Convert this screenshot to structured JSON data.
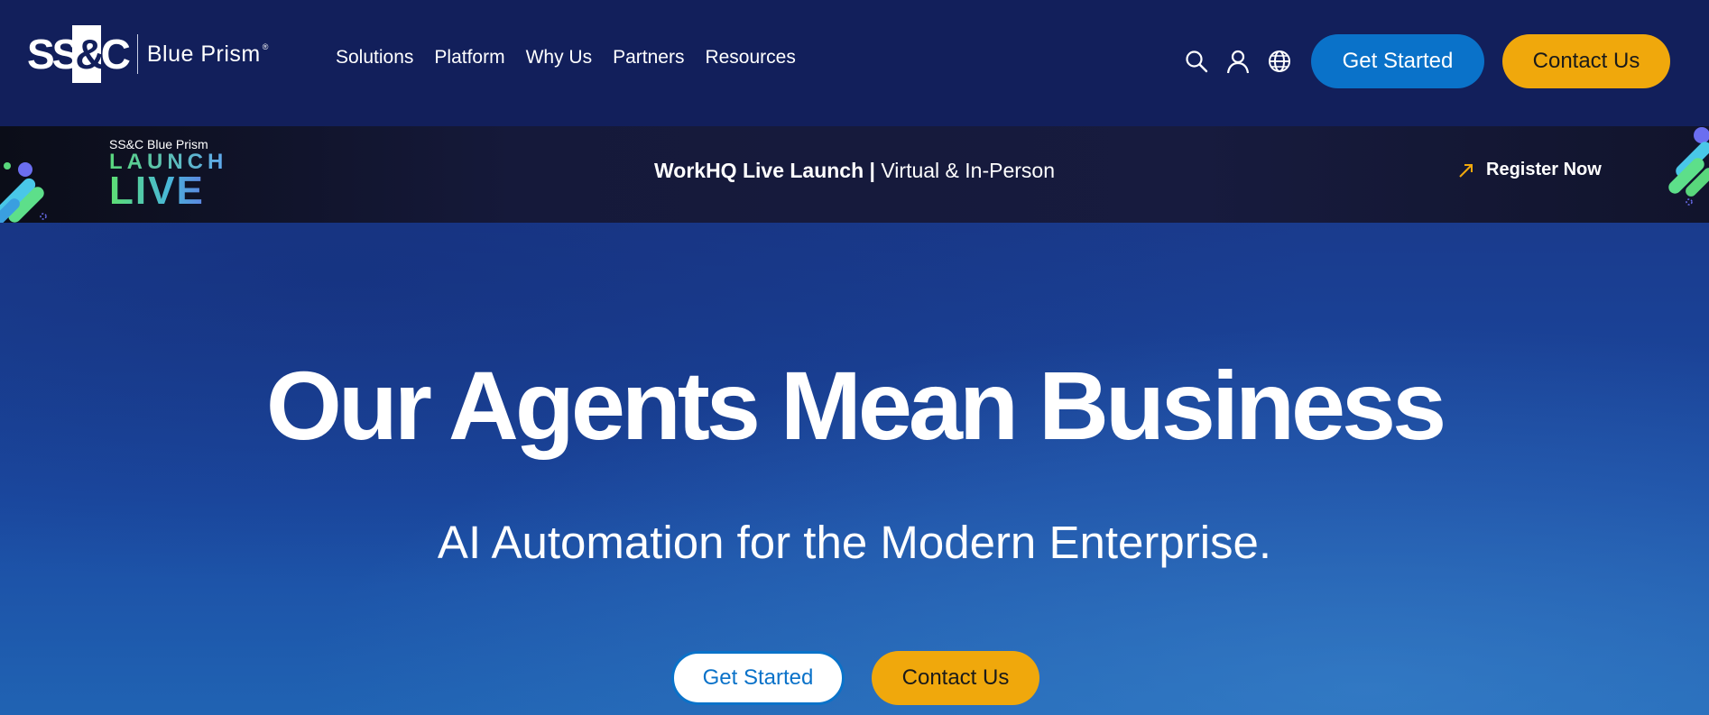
{
  "header": {
    "logo": {
      "mark": "SS&C",
      "product": "Blue Prism",
      "registered": "®"
    },
    "nav": [
      "Solutions",
      "Platform",
      "Why Us",
      "Partners",
      "Resources"
    ],
    "icons": [
      "search-icon",
      "user-icon",
      "globe-icon"
    ],
    "get_started": "Get Started",
    "contact_us": "Contact Us"
  },
  "banner": {
    "brand_top": "SS&C Blue Prism",
    "brand_launch": "LAUNCH",
    "brand_live": "LIVE",
    "event_bold": "WorkHQ Live Launch",
    "event_sep": " | ",
    "event_rest": "Virtual & In-Person",
    "register": "Register Now",
    "register_icon": "arrow-up-right-icon"
  },
  "hero": {
    "title": "Our Agents Mean Business",
    "subtitle": "AI Automation for the Modern Enterprise.",
    "get_started": "Get Started",
    "contact_us": "Contact Us"
  },
  "colors": {
    "header_bg": "#121f5b",
    "primary_blue": "#0a72c9",
    "accent_orange": "#f0a80c",
    "banner_bg": "#15193a"
  }
}
